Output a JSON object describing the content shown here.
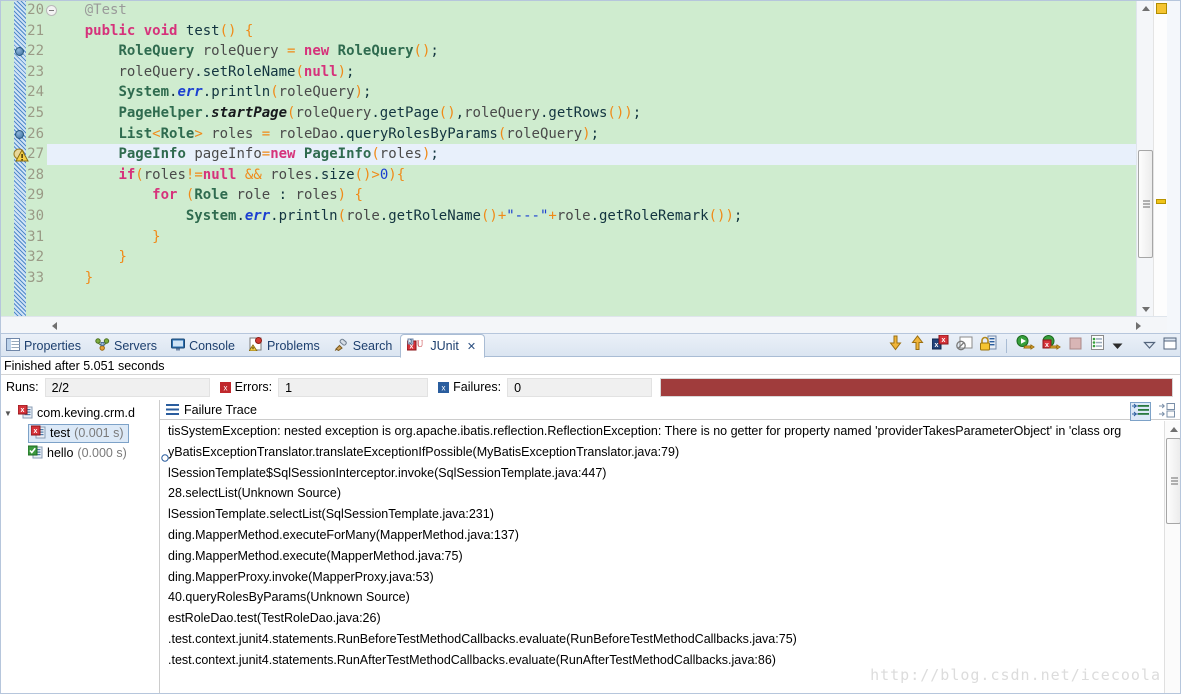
{
  "editor": {
    "gutter": [
      {
        "num": "20",
        "fold": true,
        "bp": false,
        "warn": false
      },
      {
        "num": "21",
        "fold": false,
        "bp": false,
        "warn": false
      },
      {
        "num": "22",
        "fold": false,
        "bp": true,
        "warn": false
      },
      {
        "num": "23",
        "fold": false,
        "bp": false,
        "warn": false
      },
      {
        "num": "24",
        "fold": false,
        "bp": false,
        "warn": false
      },
      {
        "num": "25",
        "fold": false,
        "bp": false,
        "warn": false
      },
      {
        "num": "26",
        "fold": false,
        "bp": true,
        "warn": false
      },
      {
        "num": "27",
        "fold": false,
        "bp": false,
        "warn": true
      },
      {
        "num": "28",
        "fold": false,
        "bp": false,
        "warn": false
      },
      {
        "num": "29",
        "fold": false,
        "bp": false,
        "warn": false
      },
      {
        "num": "30",
        "fold": false,
        "bp": false,
        "warn": false
      },
      {
        "num": "31",
        "fold": false,
        "bp": false,
        "warn": false
      },
      {
        "num": "32",
        "fold": false,
        "bp": false,
        "warn": false
      },
      {
        "num": "33",
        "fold": false,
        "bp": false,
        "warn": false
      }
    ],
    "lines": [
      "    @Test",
      "    public void test() {",
      "        RoleQuery roleQuery = new RoleQuery();",
      "        roleQuery.setRoleName(null);",
      "        System.err.println(roleQuery);",
      "        PageHelper.startPage(roleQuery.getPage(),roleQuery.getRows());",
      "        List<Role> roles = roleDao.queryRolesByParams(roleQuery);",
      "        PageInfo pageInfo=new PageInfo(roles);",
      "        if(roles!=null && roles.size()>0){",
      "            for (Role role : roles) {",
      "                System.err.println(role.getRoleName()+\"---\"+role.getRoleRemark());",
      "            }",
      "        }",
      "    }"
    ],
    "current_line_index": 7
  },
  "view_tabs": [
    {
      "label": "Properties",
      "icon": "properties-icon",
      "active": false
    },
    {
      "label": "Servers",
      "icon": "servers-icon",
      "active": false
    },
    {
      "label": "Console",
      "icon": "console-icon",
      "active": false
    },
    {
      "label": "Problems",
      "icon": "problems-icon",
      "active": false
    },
    {
      "label": "Search",
      "icon": "search-icon",
      "active": false
    },
    {
      "label": "JUnit",
      "icon": "junit-icon",
      "active": true,
      "close": "✕"
    }
  ],
  "view_toolbar": [
    {
      "name": "next-failed-test-button",
      "icon": "arrow-down-icon"
    },
    {
      "name": "previous-failed-test-button",
      "icon": "arrow-up-icon"
    },
    {
      "name": "show-failures-only-button",
      "icon": "failures-only-icon"
    },
    {
      "name": "stop-junit-button",
      "icon": "stop-circle-icon"
    },
    {
      "name": "scroll-lock-button",
      "icon": "lock-icon"
    },
    {
      "name": "rerun-test-button",
      "icon": "rerun-icon"
    },
    {
      "name": "rerun-failed-tests-button",
      "icon": "rerun-failed-icon"
    },
    {
      "name": "terminate-button",
      "icon": "terminate-icon"
    },
    {
      "name": "test-run-history-button",
      "icon": "history-icon"
    },
    {
      "name": "view-menu-button",
      "icon": "chevron-down-icon"
    },
    {
      "name": "minimize-view-button",
      "icon": "minimize-icon"
    },
    {
      "name": "maximize-view-button",
      "icon": "maximize-icon"
    }
  ],
  "junit": {
    "status": "Finished after 5.051 seconds",
    "runs_label": "Runs:",
    "runs_value": "2/2",
    "errors_label": "Errors:",
    "errors_value": "1",
    "failures_label": "Failures:",
    "failures_value": "0",
    "progress_color": "#a03c3c",
    "tree": [
      {
        "label": "com.keving.crm.d",
        "time": "",
        "icon": "test-class-error-icon",
        "level": 0,
        "selected": false,
        "expanded": true
      },
      {
        "label": "test",
        "time": "(0.001 s)",
        "icon": "test-error-icon",
        "level": 1,
        "selected": true,
        "expanded": false
      },
      {
        "label": "hello",
        "time": "(0.000 s)",
        "icon": "test-pass-icon",
        "level": 1,
        "selected": false,
        "expanded": false
      }
    ],
    "failure_trace_label": "Failure Trace",
    "trace_tools": [
      {
        "name": "filter-stack-trace-button",
        "icon": "filter-icon",
        "pressed": true
      },
      {
        "name": "compare-result-button",
        "icon": "compare-icon",
        "pressed": false
      }
    ],
    "trace_lines": [
      "tisSystemException: nested exception is org.apache.ibatis.reflection.ReflectionException: There is no getter for property named 'providerTakesParameterObject' in 'class org",
      "yBatisExceptionTranslator.translateExceptionIfPossible(MyBatisExceptionTranslator.java:79)",
      "lSessionTemplate$SqlSessionInterceptor.invoke(SqlSessionTemplate.java:447)",
      "28.selectList(Unknown Source)",
      "lSessionTemplate.selectList(SqlSessionTemplate.java:231)",
      "ding.MapperMethod.executeForMany(MapperMethod.java:137)",
      "ding.MapperMethod.execute(MapperMethod.java:75)",
      "ding.MapperProxy.invoke(MapperProxy.java:53)",
      "40.queryRolesByParams(Unknown Source)",
      "estRoleDao.test(TestRoleDao.java:26)",
      ".test.context.junit4.statements.RunBeforeTestMethodCallbacks.evaluate(RunBeforeTestMethodCallbacks.java:75)",
      ".test.context.junit4.statements.RunAfterTestMethodCallbacks.evaluate(RunAfterTestMethodCallbacks.java:86)"
    ]
  },
  "watermark": "http://blog.csdn.net/icecoola"
}
